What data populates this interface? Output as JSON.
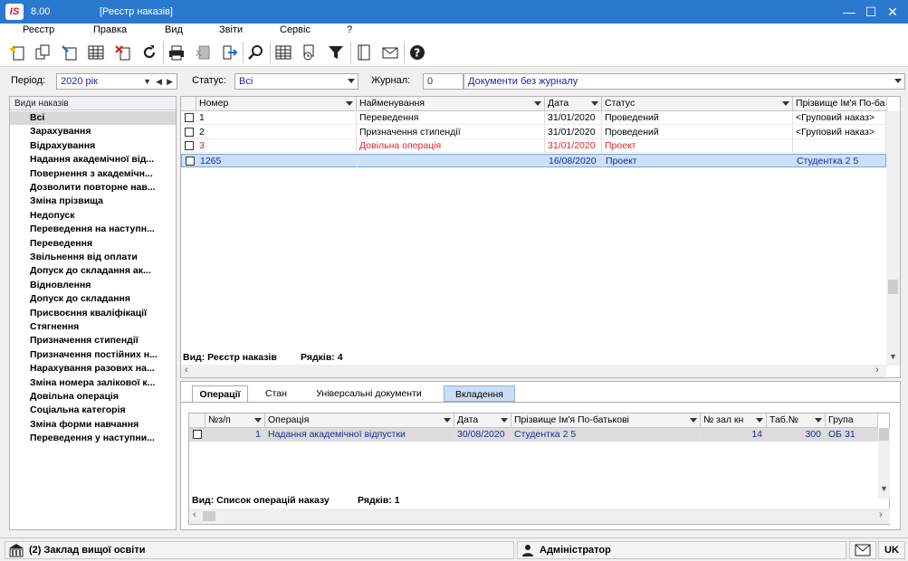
{
  "app": {
    "logo": "IS",
    "version": "8.00",
    "window_title": "[Реєстр наказів]"
  },
  "menu": [
    "Реєстр",
    "Правка",
    "Вид",
    "Звіти",
    "Сервіс",
    "?"
  ],
  "filters": {
    "period_label": "Період:",
    "period_value": "2020 рік",
    "status_label": "Статус:",
    "status_value": "Всі",
    "journal_label": "Журнал:",
    "journal_code": "0",
    "journal_name": "Документи без журналу"
  },
  "left_panel": {
    "header": "Види наказів",
    "items": [
      "Всі",
      "Зарахування",
      "Відрахування",
      "Надання академічної від...",
      "Повернення з академічн...",
      "Дозволити повторне нав...",
      "Зміна прізвища",
      "Недопуск",
      "Переведення на наступн...",
      "Переведення",
      "Звільнення від оплати",
      "Допуск до складання ак...",
      "Відновлення",
      "Допуск до складання",
      "Присвоєння кваліфікації",
      "Стягнення",
      "Призначення стипендії",
      "Призначення постійних н...",
      "Нарахування разових на...",
      "Зміна номера залікової к...",
      "Довільна операція",
      "Соціальна категорія",
      "Зміна форми навчання",
      "Переведення у наступни..."
    ],
    "selected_index": 0
  },
  "main_grid": {
    "columns": [
      "Номер",
      "Найменування",
      "Дата",
      "Статус",
      "Прізвище Ім'я По-ба"
    ],
    "rows": [
      {
        "number": "1",
        "name": "Переведення",
        "date": "31/01/2020",
        "status": "Проведений",
        "person": "<Груповий наказ>",
        "style": "normal"
      },
      {
        "number": "2",
        "name": "Призначення стипендії",
        "date": "31/01/2020",
        "status": "Проведений",
        "person": "<Груповий наказ>",
        "style": "normal"
      },
      {
        "number": "3",
        "name": "Довільна операція",
        "date": "31/01/2020",
        "status": "Проект",
        "person": "",
        "style": "red"
      },
      {
        "number": "1265",
        "name": "",
        "date": "16/08/2020",
        "status": "Проект",
        "person": "Студентка 2 5",
        "style": "selected"
      }
    ],
    "footer_view": "Вид: Реєстр наказів",
    "footer_rows": "Рядків: 4"
  },
  "tabs": [
    "Операції",
    "Стан",
    "Універсальні документи",
    "Вкладення"
  ],
  "sub_grid": {
    "columns": [
      "№з/п",
      "Операція",
      "Дата",
      "Прізвище Ім'я По-батькові",
      "№ зал кн",
      "Таб.№",
      "Група"
    ],
    "rows": [
      {
        "num": "1",
        "operation": "Надання академічної відпустки",
        "date": "30/08/2020",
        "person": "Студентка 2 5",
        "book": "14",
        "tab": "300",
        "group": "ОБ 31"
      }
    ],
    "footer_view": "Вид: Список операцій наказу",
    "footer_rows": "Рядків: 1"
  },
  "status_bar": {
    "org": "(2) Заклад вищої освіти",
    "user": "Адміністратор",
    "lang": "UK"
  },
  "colors": {
    "titlebar": "#2b78cf",
    "selected_row": "#cce0f7",
    "red_row": "#e0242a",
    "blue_text": "#1a2a9a"
  }
}
